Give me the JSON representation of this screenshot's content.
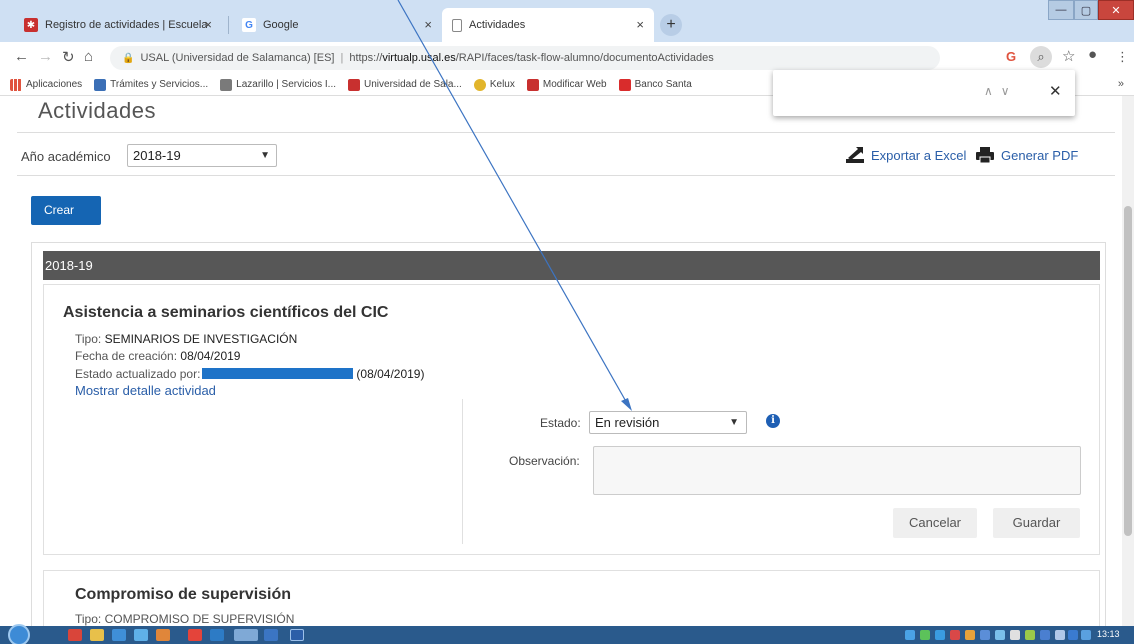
{
  "browser": {
    "tabs": [
      {
        "title": "Registro de actividades | Escuela",
        "close": "×",
        "active": false,
        "favicon": "usal-icon"
      },
      {
        "title": "Google",
        "close": "×",
        "active": false,
        "favicon": "google-icon"
      },
      {
        "title": "Actividades",
        "close": "×",
        "active": true,
        "favicon": "document-icon"
      }
    ],
    "new_tab": "+",
    "url": {
      "site_label": "USAL (Universidad de Salamanca) [ES]",
      "separator": "|",
      "prefix": "https://",
      "host": "virtualp.usal.es",
      "path": "/RAPI/faces/task-flow-alumno/documentoActividades"
    },
    "bookmarks": [
      {
        "label": "Aplicaciones",
        "icon": "apps-grid-icon",
        "color": "#e0533e"
      },
      {
        "label": "Trámites y Servicios...",
        "icon": "bookmark-icon",
        "color": "#3b6fb6"
      },
      {
        "label": "Lazarillo | Servicios I...",
        "icon": "bookmark-icon",
        "color": "#7a7a7a"
      },
      {
        "label": "Universidad de Sala...",
        "icon": "usal-icon",
        "color": "#c8302f"
      },
      {
        "label": "Kelux",
        "icon": "star-icon",
        "color": "#e2b52b"
      },
      {
        "label": "Modificar Web",
        "icon": "usal-icon",
        "color": "#c8302f"
      },
      {
        "label": "Banco Santa",
        "icon": "santander-icon",
        "color": "#d92c2c"
      }
    ],
    "bookmarks_more": "»"
  },
  "page": {
    "title": "Actividades",
    "year_label": "Año académico",
    "year_value": "2018-19",
    "export_excel": "Exportar a Excel",
    "generate_pdf": "Generar PDF",
    "create_button": "Crear",
    "year_header": "2018-19",
    "activity1": {
      "title": "Asistencia a seminarios científicos del CIC",
      "tipo_label": "Tipo:",
      "tipo_value": "SEMINARIOS DE INVESTIGACIÓN",
      "fecha_label": "Fecha de creación:",
      "fecha_value": "08/04/2019",
      "estado_by_label": "Estado actualizado por:",
      "estado_by_date": "(08/04/2019)",
      "detail_link": "Mostrar detalle actividad",
      "estado_label": "Estado:",
      "estado_value": "En revisión",
      "observacion_label": "Observación:",
      "cancel_button": "Cancelar",
      "save_button": "Guardar"
    },
    "activity2": {
      "title": "Compromiso de supervisión",
      "tipo_label": "Tipo:",
      "tipo_value": "COMPROMISO DE SUPERVISIÓN"
    }
  },
  "taskbar": {
    "clock": "13:13"
  },
  "colors": {
    "accent_blue": "#1565b3",
    "link_blue": "#2a5ea8",
    "year_bar": "#575757",
    "redaction": "#1e73c8"
  }
}
